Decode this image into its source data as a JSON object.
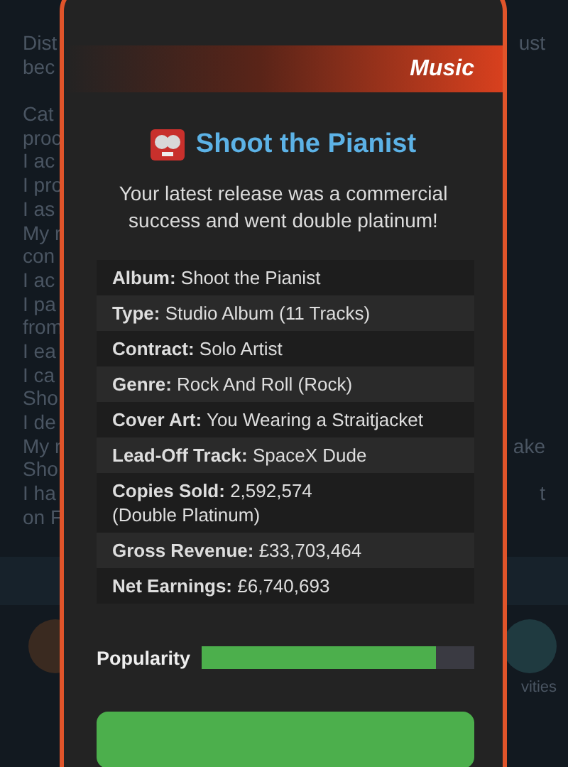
{
  "background": {
    "paragraphs": [
      [
        {
          "left": "Dist",
          "right": "ust"
        },
        {
          "left": "bec"
        }
      ],
      [
        {
          "left": "Cat"
        },
        {
          "left": "proc"
        },
        {
          "left": "I ac"
        },
        {
          "left": "I pro"
        },
        {
          "left": "I as"
        },
        {
          "left": "My r"
        },
        {
          "left": "con"
        },
        {
          "left": "I ac"
        },
        {
          "left": "I pa"
        },
        {
          "left": "from"
        },
        {
          "left": "I ea"
        },
        {
          "left": "I ca"
        },
        {
          "left": "Sho"
        },
        {
          "left": "I de"
        },
        {
          "left": "My r",
          "right": "ake"
        },
        {
          "left": "Sho"
        },
        {
          "left": "I ha",
          "right": "t"
        },
        {
          "left": "on F"
        }
      ]
    ],
    "activity_label": "vities"
  },
  "modal": {
    "category": "Music",
    "title": "Shoot the Pianist",
    "message": "Your latest release was a commercial success and went double platinum!",
    "details": [
      {
        "label": "Album:",
        "value": "Shoot the Pianist"
      },
      {
        "label": "Type:",
        "value": "Studio Album (11 Tracks)"
      },
      {
        "label": "Contract:",
        "value": "Solo Artist"
      },
      {
        "label": "Genre:",
        "value": "Rock And Roll (Rock)"
      },
      {
        "label": "Cover Art:",
        "value": "You Wearing a Straitjacket"
      },
      {
        "label": "Lead-Off Track:",
        "value": "SpaceX Dude"
      },
      {
        "label": "Copies Sold:",
        "value": "2,592,574",
        "note": "(Double Platinum)"
      },
      {
        "label": "Gross Revenue:",
        "value": "£33,703,464"
      },
      {
        "label": "Net Earnings:",
        "value": "£6,740,693"
      }
    ],
    "popularity": {
      "label": "Popularity",
      "level": 0.86
    }
  }
}
